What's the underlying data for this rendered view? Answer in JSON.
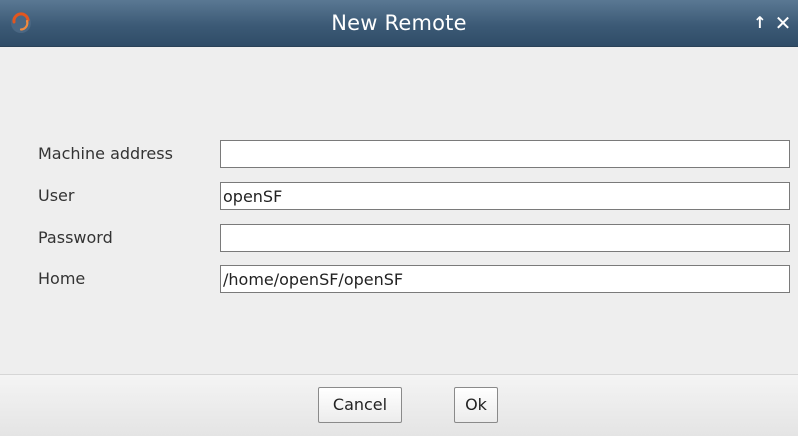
{
  "window": {
    "title": "New Remote",
    "maximize_glyph": "↑",
    "close_glyph": "✕",
    "app_icon": "swirl-icon",
    "titlebar_color": "#3c5a76",
    "icon_accent": "#e2561f"
  },
  "form": {
    "fields": [
      {
        "label": "Machine address",
        "value": ""
      },
      {
        "label": "User",
        "value": "openSF"
      },
      {
        "label": "Password",
        "value": ""
      },
      {
        "label": "Home",
        "value": "/home/openSF/openSF"
      }
    ]
  },
  "buttons": {
    "cancel": "Cancel",
    "ok": "Ok"
  }
}
